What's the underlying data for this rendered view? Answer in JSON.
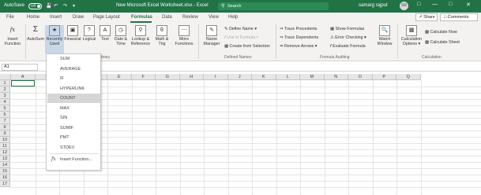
{
  "titlebar": {
    "autosave_label": "AutoSave",
    "autosave_state": "Off",
    "doc_title": "New Microsoft Excel Worksheet.xlsx - Excel",
    "search_placeholder": "Search",
    "user_name": "samarg rajput",
    "user_initials": "SR"
  },
  "tabs": [
    "File",
    "Home",
    "Insert",
    "Draw",
    "Page Layout",
    "Formulas",
    "Data",
    "Review",
    "View",
    "Help"
  ],
  "active_tab": "Formulas",
  "share_label": "Share",
  "comments_label": "Comments",
  "ribbon": {
    "insert_function": [
      "Insert",
      "Function"
    ],
    "autosum": "AutoSum",
    "recently_used": [
      "Recently",
      "Used"
    ],
    "financial": "Financial",
    "logical": "Logical",
    "text": "Text",
    "date_time": [
      "Date &",
      "Time"
    ],
    "lookup": [
      "Lookup &",
      "Reference"
    ],
    "math": [
      "Math &",
      "Trig"
    ],
    "more": [
      "More",
      "Functions"
    ],
    "name_manager": [
      "Name",
      "Manager"
    ],
    "define_name": "Define Name",
    "use_in_formula": "Use in Formula",
    "create_from_selection": "Create from Selection",
    "trace_precedents": "Trace Precedents",
    "trace_dependents": "Trace Dependents",
    "remove_arrows": "Remove Arrows",
    "show_formulas": "Show Formulas",
    "error_checking": "Error Checking",
    "evaluate_formula": "Evaluate Formula",
    "watch_window": [
      "Watch",
      "Window"
    ],
    "calc_options": [
      "Calculation",
      "Options"
    ],
    "calc_now": "Calculate Now",
    "calc_sheet": "Calculate Sheet",
    "groups": {
      "library_tail": "Library",
      "defined_names": "Defined Names",
      "formula_auditing": "Formula Auditing",
      "calculation": "Calculation"
    }
  },
  "namebox": "A1",
  "columns": [
    "A",
    "B",
    "C",
    "D",
    "E",
    "F",
    "G",
    "H",
    "I",
    "J",
    "K",
    "L",
    "M",
    "N",
    "O",
    "P",
    "Q"
  ],
  "rows": [
    "1",
    "2",
    "3",
    "4",
    "5",
    "6",
    "7",
    "8",
    "9",
    "10",
    "11",
    "12",
    "13",
    "14",
    "15",
    "16",
    "17"
  ],
  "recent_menu": {
    "items": [
      "SUM",
      "AVERAGE",
      "IF",
      "HYPERLINK",
      "COUNT",
      "MAX",
      "SIN",
      "SUMIF",
      "PMT",
      "STDEV"
    ],
    "highlighted": "COUNT",
    "footer": "Insert Function..."
  },
  "colors": {
    "excel_green": "#217346",
    "ribbon_bg": "#f3f2f1"
  }
}
